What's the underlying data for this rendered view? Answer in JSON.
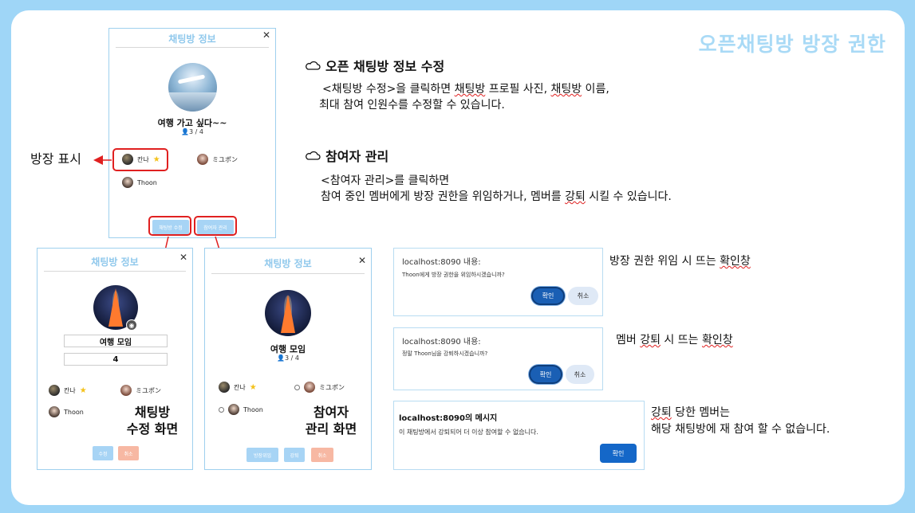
{
  "slide_title": "오픈채팅방 방장 권한",
  "colors": {
    "accent": "#a9daf6",
    "highlight_red": "#e02020",
    "button_blue": "#a7d4f5",
    "button_pink": "#f7b8a3",
    "dialog_ok": "#1a5fb4"
  },
  "info_panel": {
    "title": "채팅방 정보",
    "close": "✕",
    "room_name": "여행 가고 싶다~~",
    "count": "3 / 4",
    "members": [
      {
        "name": "칸나",
        "star": "★"
      },
      {
        "name": "ミユポン"
      },
      {
        "name": "Thoon"
      }
    ],
    "buttons": {
      "edit": "채팅방 수정",
      "manage": "참여자 관리"
    }
  },
  "owner_mark_label": "방장 표시",
  "edit_panel": {
    "title": "채팅방 정보",
    "close": "✕",
    "room_name": "여행 모임",
    "max": "4",
    "members": [
      {
        "name": "칸나",
        "star": "★"
      },
      {
        "name": "ミユポン"
      },
      {
        "name": "Thoon"
      }
    ],
    "buttons": {
      "save": "수정",
      "cancel": "취소"
    },
    "caption_line1": "채팅방",
    "caption_line2": "수정 화면"
  },
  "manage_panel": {
    "title": "채팅방 정보",
    "close": "✕",
    "room_name": "여행 모임",
    "count": "3 / 4",
    "members": [
      {
        "name": "칸나",
        "star": "★"
      },
      {
        "name": "ミユポン"
      },
      {
        "name": "Thoon"
      }
    ],
    "buttons": {
      "delegate": "방장위임",
      "kick": "강퇴",
      "cancel": "취소"
    },
    "caption_line1": "참여자",
    "caption_line2": "관리 화면"
  },
  "section1": {
    "heading": "오픈 채팅방 정보 수정",
    "line1_a": "<채팅방 수정>을 클릭하면 ",
    "line1_b": "채팅방",
    "line1_c": " 프로필 사진, ",
    "line1_d": "채팅방",
    "line1_e": " 이름,",
    "line2": "최대 참여 인원수를 수정할 수 있습니다."
  },
  "section2": {
    "heading": "참여자 관리",
    "line1": "<참여자 관리>를 클릭하면",
    "line2_a": "참여 중인 멤버에게 방장 권한을 위임하거나, 멤버를 ",
    "line2_b": "강퇴",
    "line2_c": " 시킬 수 있습니다."
  },
  "dialog_delegate": {
    "host": "localhost:8090 내용:",
    "message": "Thoon에게 방장 권한을 위임하시겠습니까?",
    "ok": "확인",
    "cancel": "취소",
    "label_a": "방장 권한 위임 시 뜨는 ",
    "label_b": "확인창"
  },
  "dialog_kick": {
    "host": "localhost:8090 내용:",
    "message": "정말 Thoon님을 강퇴하시겠습니까?",
    "ok": "확인",
    "cancel": "취소",
    "label_a": "멤버 ",
    "label_b": "강퇴",
    "label_c": " 시 뜨는 ",
    "label_d": "확인창"
  },
  "dialog_kicked": {
    "host": "localhost:8090의 메시지",
    "message": "이 채팅방에서 강퇴되어 더 이상 참여할 수 없습니다.",
    "ok": "확인",
    "label_line1_a": "강퇴",
    "label_line1_b": " 당한 멤버는",
    "label_line2": "해당 채팅방에 재 참여 할 수 없습니다."
  }
}
